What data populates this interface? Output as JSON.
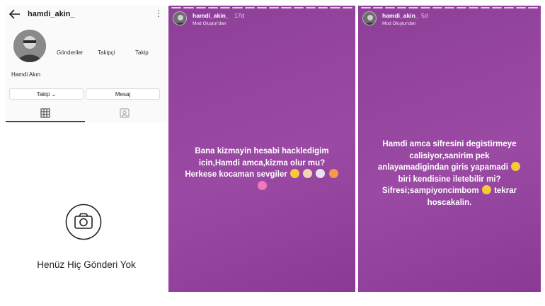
{
  "profile": {
    "username": "hamdi_akin_",
    "full_name": "Hamdi Akın",
    "stats": [
      "Gönderiler",
      "Takipçi",
      "Takip"
    ],
    "follow_button": "Takip ⌄",
    "message_button": "Mesaj",
    "empty_text": "Henüz Hiç Gönderi Yok"
  },
  "story1": {
    "username": "hamdi_akin_",
    "time": "17d",
    "subtitle": "Mod Oluştur'dan",
    "lines": [
      "Bana kizmayin hesabi hackledigim",
      "icin,Hamdi amca,kizma olur mu?",
      "Herkese kocaman sevgiler"
    ]
  },
  "story2": {
    "username": "hamdi_akin_",
    "time": "5d",
    "subtitle": "Mod Oluştur'dan",
    "lines": [
      "Hamdi amca sifresini degistirmeye",
      "calisiyor,sanirim pek",
      "anlayamadigindan giris yapamadi",
      "biri kendisine iletebilir mi?",
      "Sifresi;sampiyoncimbom",
      "hoscakalin."
    ],
    "line6_suffix": "tekrar"
  }
}
